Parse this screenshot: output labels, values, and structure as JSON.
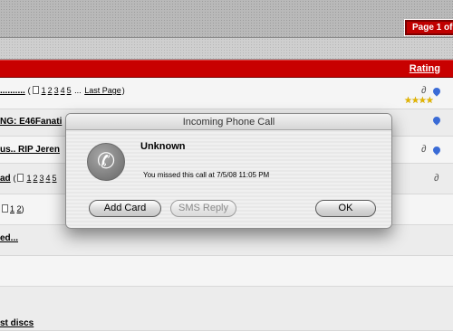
{
  "header": {
    "page_indicator": "Page 1 of 2"
  },
  "table": {
    "rating_label": "Rating",
    "rows": [
      {
        "title": "..........",
        "open_paren": "(",
        "pages": [
          "1",
          "2",
          "3",
          "4",
          "5"
        ],
        "ellipsis": "...",
        "last_page": "Last Page",
        "close_paren": ")"
      },
      {
        "title": "NG: E46Fanati"
      },
      {
        "title": "us.. RIP Jeren"
      },
      {
        "title": "ad",
        "open_paren": "(",
        "pages": [
          "1",
          "2",
          "3",
          "4",
          "5"
        ]
      },
      {
        "open_paren": "",
        "pages": [
          "1",
          "2"
        ],
        "close_paren": ")"
      },
      {
        "title": "ed..."
      },
      {
        "title": "st discs"
      }
    ]
  },
  "dialog": {
    "title": "Incoming Phone Call",
    "icon": "phone-icon",
    "caller": "Unknown",
    "message": "You missed this call at 7/5/08 11:05 PM",
    "buttons": {
      "add_card": "Add Card",
      "sms_reply": "SMS Reply",
      "ok": "OK"
    }
  },
  "colors": {
    "header_red": "#c80000",
    "pager_red": "#c00000",
    "star": "#e2b400",
    "pin": "#3a6bd6"
  }
}
